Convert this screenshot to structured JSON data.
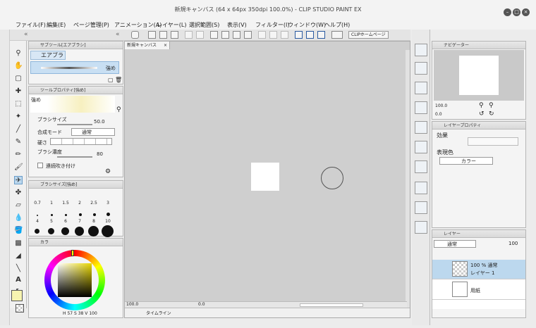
{
  "window": {
    "title": "新規キャンバス (64 x 64px 350dpi 100.0%)  - CLIP STUDIO PAINT EX"
  },
  "menu": [
    "ファイル(F)",
    "編集(E)",
    "ページ管理(P)",
    "アニメーション(A)",
    "レイヤー(L)",
    "選択範囲(S)",
    "表示(V)",
    "フィルター(I)",
    "ウィンドウ(W)",
    "ヘルプ(H)"
  ],
  "command_bar": {
    "clip_home": "CLIPホームページ"
  },
  "subtool": {
    "header": "サブツール[エアブラシ]",
    "group": "エアブラシ",
    "selected": "強め"
  },
  "tool_property": {
    "header": "ツールプロパティ[強め]",
    "preview_label": "強め",
    "brush_size_label": "ブラシサイズ",
    "brush_size_value": "50.0",
    "blend_mode_label": "合成モード",
    "blend_mode_value": "通常",
    "hardness_label": "硬さ",
    "density_label": "ブラシ濃度",
    "density_value": "80",
    "continuous_label": "連続吹き付け"
  },
  "brush_size": {
    "header": "ブラシサイズ[強め]",
    "sizes": [
      "0.7",
      "1",
      "1.5",
      "2",
      "2.5",
      "3",
      "4",
      "5",
      "6",
      "7",
      "8",
      "10"
    ]
  },
  "color": {
    "tab": "カラ",
    "h": "57",
    "s": "38",
    "v": "100",
    "h_icon": "H",
    "s_icon": "S",
    "v_icon": "V"
  },
  "canvas": {
    "tab": "新規キャンバス",
    "zoom": "100.0",
    "angle": "0.0",
    "timeline": "タイムライン"
  },
  "navigator": {
    "tab": "ナビゲーター",
    "zoom": "100.0",
    "angle": "0.0"
  },
  "layer_property": {
    "tab": "レイヤープロパティ",
    "effect_label": "効果",
    "expression_label": "表現色",
    "expression_value": "カラー"
  },
  "layers": {
    "tab": "レイヤー",
    "blend": "通常",
    "opacity": "100",
    "items": [
      {
        "info": "100 % 通常",
        "name": "レイヤー 1"
      },
      {
        "info": "",
        "name": "用紙"
      }
    ]
  },
  "colors": {
    "accent": "#c8dff3",
    "selected": "#bcd8ee",
    "canvas_bg": "#cfcfcf"
  }
}
